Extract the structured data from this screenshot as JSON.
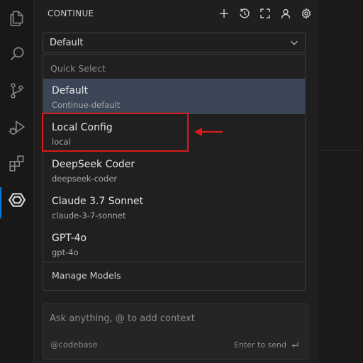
{
  "colors": {
    "accent": "#0078d4",
    "selected_bg": "#3a4556",
    "highlight": "#d91a1a"
  },
  "activity_bar": {
    "items": [
      {
        "icon": "files-icon"
      },
      {
        "icon": "search-icon"
      },
      {
        "icon": "source-control-icon"
      },
      {
        "icon": "run-debug-icon"
      },
      {
        "icon": "extensions-icon"
      },
      {
        "icon": "continue-logo-icon",
        "active": true
      }
    ]
  },
  "header": {
    "title": "CONTINUE",
    "actions": [
      "plus-icon",
      "history-icon",
      "fullscreen-icon",
      "account-icon",
      "gear-icon"
    ]
  },
  "model_select": {
    "value": "Default"
  },
  "dropdown": {
    "heading": "Quick Select",
    "items": [
      {
        "name": "Default",
        "id": "Continue-default",
        "selected": true
      },
      {
        "name": "Local Config",
        "id": "local"
      },
      {
        "name": "DeepSeek Coder",
        "id": "deepseek-coder"
      },
      {
        "name": "Claude 3.7 Sonnet",
        "id": "claude-3-7-sonnet"
      },
      {
        "name": "GPT-4o",
        "id": "gpt-4o"
      }
    ],
    "footer": "Manage Models"
  },
  "input": {
    "placeholder": "Ask anything, @ to add context",
    "context": "@codebase",
    "send_hint": "Enter to send"
  }
}
